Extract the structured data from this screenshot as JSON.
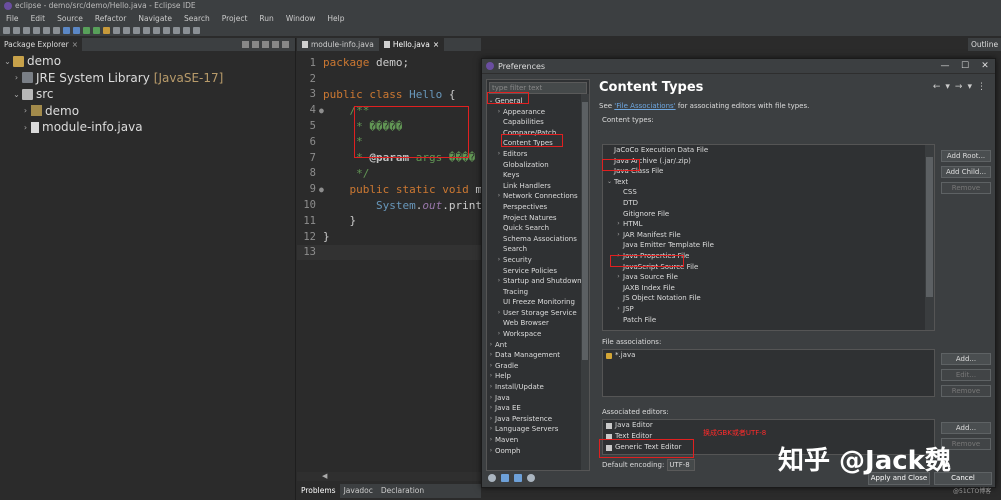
{
  "window": {
    "title": "eclipse - demo/src/demo/Hello.java - Eclipse IDE"
  },
  "menu": [
    "File",
    "Edit",
    "Source",
    "Refactor",
    "Navigate",
    "Search",
    "Project",
    "Run",
    "Window",
    "Help"
  ],
  "package_explorer": {
    "tab_label": "Package Explorer",
    "tree": [
      {
        "label": "demo",
        "level": 0,
        "expanded": true,
        "icon": "project-icon"
      },
      {
        "label": "JRE System Library",
        "decor": "[JavaSE-17]",
        "level": 1,
        "expanded": false,
        "icon": "library-icon"
      },
      {
        "label": "src",
        "level": 1,
        "expanded": true,
        "icon": "folder-icon"
      },
      {
        "label": "demo",
        "level": 2,
        "expanded": false,
        "icon": "package-icon"
      },
      {
        "label": "module-info.java",
        "level": 2,
        "expanded": false,
        "icon": "java-file-icon"
      }
    ]
  },
  "editor": {
    "tabs": [
      {
        "label": "module-info.java",
        "active": false
      },
      {
        "label": "Hello.java",
        "active": true
      }
    ],
    "line_numbers": [
      "1",
      "2",
      "3",
      "4",
      "5",
      "6",
      "7",
      "8",
      "9",
      "10",
      "11",
      "12",
      "13"
    ]
  },
  "bottom_tabs": [
    "Problems",
    "Javadoc",
    "Declaration"
  ],
  "outline_tab": "Outline",
  "preferences": {
    "title": "Preferences",
    "filter_placeholder": "type filter text",
    "tree": [
      {
        "label": "General",
        "level": 0,
        "arrow": "v"
      },
      {
        "label": "Appearance",
        "level": 1,
        "arrow": ">"
      },
      {
        "label": "Capabilities",
        "level": 1,
        "arrow": ""
      },
      {
        "label": "Compare/Patch",
        "level": 1,
        "arrow": ""
      },
      {
        "label": "Content Types",
        "level": 1,
        "arrow": ""
      },
      {
        "label": "Editors",
        "level": 1,
        "arrow": ">"
      },
      {
        "label": "Globalization",
        "level": 1,
        "arrow": ""
      },
      {
        "label": "Keys",
        "level": 1,
        "arrow": ""
      },
      {
        "label": "Link Handlers",
        "level": 1,
        "arrow": ""
      },
      {
        "label": "Network Connections",
        "level": 1,
        "arrow": ">"
      },
      {
        "label": "Perspectives",
        "level": 1,
        "arrow": ""
      },
      {
        "label": "Project Natures",
        "level": 1,
        "arrow": ""
      },
      {
        "label": "Quick Search",
        "level": 1,
        "arrow": ""
      },
      {
        "label": "Schema Associations",
        "level": 1,
        "arrow": ""
      },
      {
        "label": "Search",
        "level": 1,
        "arrow": ""
      },
      {
        "label": "Security",
        "level": 1,
        "arrow": ">"
      },
      {
        "label": "Service Policies",
        "level": 1,
        "arrow": ""
      },
      {
        "label": "Startup and Shutdown",
        "level": 1,
        "arrow": ">"
      },
      {
        "label": "Tracing",
        "level": 1,
        "arrow": ""
      },
      {
        "label": "UI Freeze Monitoring",
        "level": 1,
        "arrow": ""
      },
      {
        "label": "User Storage Service",
        "level": 1,
        "arrow": ">"
      },
      {
        "label": "Web Browser",
        "level": 1,
        "arrow": ""
      },
      {
        "label": "Workspace",
        "level": 1,
        "arrow": ">"
      },
      {
        "label": "Ant",
        "level": 0,
        "arrow": ">"
      },
      {
        "label": "Data Management",
        "level": 0,
        "arrow": ">"
      },
      {
        "label": "Gradle",
        "level": 0,
        "arrow": ">"
      },
      {
        "label": "Help",
        "level": 0,
        "arrow": ">"
      },
      {
        "label": "Install/Update",
        "level": 0,
        "arrow": ">"
      },
      {
        "label": "Java",
        "level": 0,
        "arrow": ">"
      },
      {
        "label": "Java EE",
        "level": 0,
        "arrow": ">"
      },
      {
        "label": "Java Persistence",
        "level": 0,
        "arrow": ">"
      },
      {
        "label": "Language Servers",
        "level": 0,
        "arrow": ">"
      },
      {
        "label": "Maven",
        "level": 0,
        "arrow": ">"
      },
      {
        "label": "Oomph",
        "level": 0,
        "arrow": ">"
      }
    ],
    "page_title": "Content Types",
    "desc_prefix": "See ",
    "desc_link": "'File Associations'",
    "desc_suffix": " for associating editors with file types.",
    "content_types_label": "Content types:",
    "content_types": [
      {
        "label": "JaCoCo Execution Data File",
        "level": 0,
        "arrow": ""
      },
      {
        "label": "Java Archive (.jar/.zip)",
        "level": 0,
        "arrow": ""
      },
      {
        "label": "Java Class File",
        "level": 0,
        "arrow": ""
      },
      {
        "label": "Text",
        "level": 0,
        "arrow": "v"
      },
      {
        "label": "CSS",
        "level": 1,
        "arrow": ""
      },
      {
        "label": "DTD",
        "level": 1,
        "arrow": ""
      },
      {
        "label": "Gitignore File",
        "level": 1,
        "arrow": ""
      },
      {
        "label": "HTML",
        "level": 1,
        "arrow": ">"
      },
      {
        "label": "JAR Manifest File",
        "level": 1,
        "arrow": ">"
      },
      {
        "label": "Java Emitter Template File",
        "level": 1,
        "arrow": ""
      },
      {
        "label": "Java Properties File",
        "level": 1,
        "arrow": ">"
      },
      {
        "label": "JavaScript Source File",
        "level": 1,
        "arrow": ""
      },
      {
        "label": "Java Source File",
        "level": 1,
        "arrow": ">"
      },
      {
        "label": "JAXB Index File",
        "level": 1,
        "arrow": ""
      },
      {
        "label": "JS Object Notation File",
        "level": 1,
        "arrow": ""
      },
      {
        "label": "JSP",
        "level": 1,
        "arrow": ">"
      },
      {
        "label": "Patch File",
        "level": 1,
        "arrow": ""
      }
    ],
    "ct_buttons": {
      "add_root": "Add Root...",
      "add_child": "Add Child...",
      "remove": "Remove"
    },
    "file_assoc_label": "File associations:",
    "file_associations": [
      "*.java"
    ],
    "fa_buttons": {
      "add": "Add...",
      "edit": "Edit...",
      "remove": "Remove"
    },
    "assoc_editors_label": "Associated editors:",
    "associated_editors": [
      "Java Editor",
      "Text Editor",
      "Generic Text Editor"
    ],
    "ae_buttons": {
      "add": "Add...",
      "remove": "Remove"
    },
    "default_encoding_label": "Default encoding:",
    "default_encoding_value": "UTF-8",
    "buttons": {
      "apply_close": "Apply and Close",
      "cancel": "Cancel"
    }
  },
  "annotation": "换成GBK或者UTF-8",
  "watermark": {
    "main": "知乎 @Jack魏",
    "small": "@51CTO博客"
  },
  "colors": {
    "keyword": "#cc7832",
    "class": "#6897bb",
    "comment": "#629755",
    "annotation_red": "#e02020"
  }
}
